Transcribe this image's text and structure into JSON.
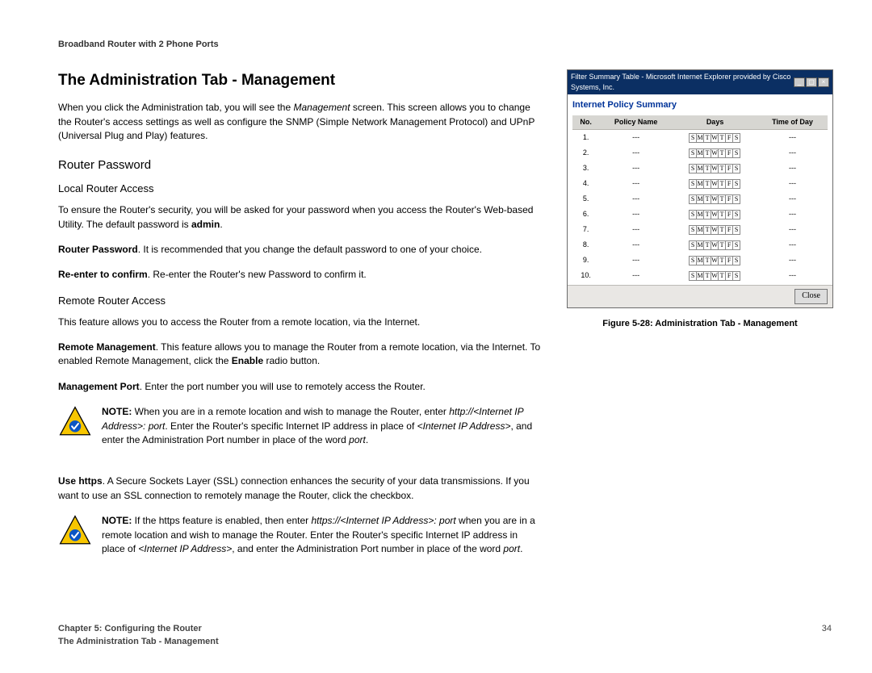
{
  "header": "Broadband Router with 2 Phone Ports",
  "title": "The Administration Tab - Management",
  "intro": "When you click the Administration tab, you will see the ",
  "intro_em": "Management",
  "intro2": " screen. This screen allows you to change the Router's access settings as well as configure the SNMP (Simple Network Management Protocol) and UPnP (Universal Plug and Play) features.",
  "sec_router_pw": "Router Password",
  "sec_local": "Local Router Access",
  "p_local1": "To ensure the Router's security, you will be asked for your password when you access the Router's Web-based Utility. The default password is ",
  "p_local1_b": "admin",
  "p_local1_end": ".",
  "p_rp_b": "Router Password",
  "p_rp": ". It is recommended that you change the default password to one of your choice.",
  "p_re_b": "Re-enter to confirm",
  "p_re": ". Re-enter the Router's new Password to confirm it.",
  "sec_remote": "Remote Router Access",
  "p_remote_intro": "This feature allows you to access the Router from a remote location, via the Internet.",
  "p_rm_b": "Remote Management",
  "p_rm": ". This feature allows you to manage the Router from a remote location, via the Internet. To enabled Remote Management, click the ",
  "p_rm_b2": "Enable",
  "p_rm_end": " radio button.",
  "p_mp_b": "Management Port",
  "p_mp": ". Enter the port number you will use to remotely access the Router.",
  "note1_b": "NOTE:",
  "note1_a": " When you are in a remote location and wish to manage the Router, enter ",
  "note1_i1": "http://<Internet IP Address>: port",
  "note1_b2": ". Enter the Router's specific Internet IP address in place of ",
  "note1_i2": "<Internet IP Address>",
  "note1_c": ", and enter the Administration Port number in place of the word ",
  "note1_i3": "port",
  "note1_d": ".",
  "p_https_b": "Use https",
  "p_https": ". A Secure Sockets Layer (SSL) connection enhances the security of your data transmissions. If you want to use an SSL connection to remotely manage the Router, click the checkbox.",
  "note2_b": "NOTE:",
  "note2_a": " If the https feature is enabled, then enter ",
  "note2_i1": "https://<Internet IP Address>: port",
  "note2_b2": " when you are in a remote location and wish to manage the Router. Enter the Router's specific Internet IP address in place of ",
  "note2_i2": "<Internet IP Address>",
  "note2_c": ", and enter the Administration Port number in place of the word ",
  "note2_i3": "port",
  "note2_d": ".",
  "fig": {
    "window_title": "Filter Summary Table - Microsoft Internet Explorer provided by Cisco Systems, Inc.",
    "heading": "Internet Policy Summary",
    "cols": {
      "no": "No.",
      "policy": "Policy Name",
      "days": "Days",
      "tod": "Time of Day"
    },
    "day_letters": [
      "S",
      "M",
      "T",
      "W",
      "T",
      "F",
      "S"
    ],
    "rows": [
      "1.",
      "2.",
      "3.",
      "4.",
      "5.",
      "6.",
      "7.",
      "8.",
      "9.",
      "10."
    ],
    "dash": "---",
    "close": "Close",
    "caption": "Figure 5-28: Administration Tab - Management"
  },
  "footer": {
    "chapter": "Chapter 5: Configuring the Router",
    "section": "The Administration Tab - Management",
    "page": "34"
  }
}
